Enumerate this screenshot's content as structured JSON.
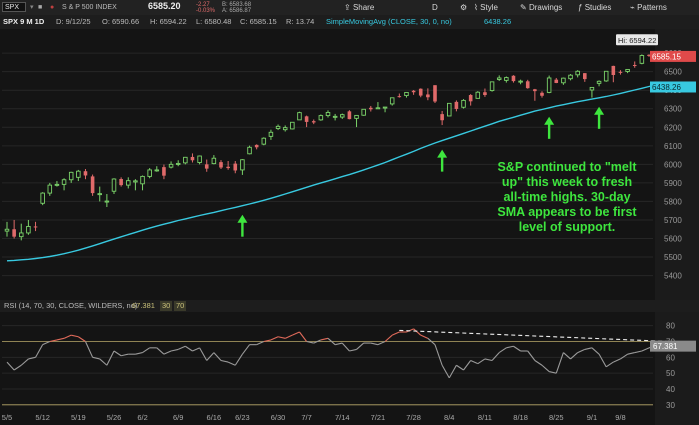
{
  "toolbar": {
    "symbol": "SPX",
    "description": "S & P 500 INDEX",
    "last_price": "6585.20",
    "change": "-2.27",
    "change_pct": "-0.03%",
    "bid": "B: 6583.68",
    "ask": "A: 6586.87",
    "share_label": "Share",
    "interval_label": "D",
    "style_label": "Style",
    "drawings_label": "Drawings",
    "studies_label": "Studies",
    "patterns_label": "Patterns"
  },
  "ohlc_bar": {
    "chart_label": "SPX 9 M 1D",
    "date": "D: 9/12/25",
    "open": "O: 6590.66",
    "high": "H: 6594.22",
    "low": "L: 6580.48",
    "close": "C: 6585.15",
    "range": "R: 13.74",
    "sma_label": "SimpleMovingAvg (CLOSE, 30, 0, no)",
    "sma_value": "6438.26"
  },
  "rsi_bar": {
    "label": "RSI (14, 70, 30, CLOSE, WILDERS, no)",
    "value": "67.381",
    "ob": "30",
    "os": "70"
  },
  "annotation": {
    "lines": [
      "S&P continued to \"melt",
      "up\" this week to fresh",
      "all-time highs. 30-day",
      "SMA appears to be first",
      "level of support."
    ]
  },
  "price_badges": {
    "hi": "Hi: 6594.22",
    "close": "6585.15",
    "sma": "6438.26"
  },
  "colors": {
    "up": "#7bd36a",
    "down": "#e06a6a",
    "sma": "#38c9e0",
    "rsi": "#9a9a9a",
    "rsi_ob": "#e06a5a",
    "annotation": "#3ee63e",
    "arrow": "#3ee63e"
  },
  "chart_data": [
    {
      "type": "candlestick",
      "y_ticks": [
        5400,
        5500,
        5600,
        5700,
        5800,
        5900,
        6000,
        6100,
        6200,
        6300,
        6400,
        6500,
        6600
      ],
      "ylim": [
        5360,
        6660
      ],
      "x_tick_labels": [
        "5/5",
        "5/12",
        "5/19",
        "5/26",
        "6/2",
        "6/9",
        "6/16",
        "6/23",
        "6/30",
        "7/7",
        "7/14",
        "7/21",
        "7/28",
        "8/4",
        "8/11",
        "8/18",
        "8/25",
        "9/1",
        "9/8"
      ],
      "candles": [
        {
          "date": "5/5",
          "o": 5640,
          "h": 5690,
          "l": 5610,
          "c": 5650
        },
        {
          "date": "5/6",
          "o": 5650,
          "h": 5700,
          "l": 5600,
          "c": 5610
        },
        {
          "date": "5/7",
          "o": 5610,
          "h": 5680,
          "l": 5590,
          "c": 5630
        },
        {
          "date": "5/8",
          "o": 5630,
          "h": 5700,
          "l": 5620,
          "c": 5665
        },
        {
          "date": "5/9",
          "o": 5665,
          "h": 5690,
          "l": 5640,
          "c": 5660
        },
        {
          "date": "5/12",
          "o": 5790,
          "h": 5850,
          "l": 5780,
          "c": 5845
        },
        {
          "date": "5/13",
          "o": 5845,
          "h": 5900,
          "l": 5830,
          "c": 5888
        },
        {
          "date": "5/14",
          "o": 5888,
          "h": 5910,
          "l": 5880,
          "c": 5892
        },
        {
          "date": "5/15",
          "o": 5892,
          "h": 5925,
          "l": 5860,
          "c": 5917
        },
        {
          "date": "5/16",
          "o": 5917,
          "h": 5960,
          "l": 5900,
          "c": 5957
        },
        {
          "date": "5/19",
          "o": 5930,
          "h": 5970,
          "l": 5910,
          "c": 5963
        },
        {
          "date": "5/20",
          "o": 5963,
          "h": 5975,
          "l": 5920,
          "c": 5940
        },
        {
          "date": "5/21",
          "o": 5935,
          "h": 5945,
          "l": 5830,
          "c": 5845
        },
        {
          "date": "5/22",
          "o": 5840,
          "h": 5880,
          "l": 5800,
          "c": 5842
        },
        {
          "date": "5/23",
          "o": 5800,
          "h": 5840,
          "l": 5770,
          "c": 5802
        },
        {
          "date": "5/27",
          "o": 5855,
          "h": 5925,
          "l": 5840,
          "c": 5921
        },
        {
          "date": "5/28",
          "o": 5921,
          "h": 5930,
          "l": 5880,
          "c": 5888
        },
        {
          "date": "5/29",
          "o": 5888,
          "h": 5930,
          "l": 5870,
          "c": 5912
        },
        {
          "date": "5/30",
          "o": 5905,
          "h": 5920,
          "l": 5860,
          "c": 5911
        },
        {
          "date": "6/2",
          "o": 5895,
          "h": 5940,
          "l": 5860,
          "c": 5935
        },
        {
          "date": "6/3",
          "o": 5935,
          "h": 5980,
          "l": 5925,
          "c": 5970
        },
        {
          "date": "6/4",
          "o": 5970,
          "h": 5990,
          "l": 5960,
          "c": 5970
        },
        {
          "date": "6/5",
          "o": 5985,
          "h": 5999,
          "l": 5920,
          "c": 5939
        },
        {
          "date": "6/6",
          "o": 5985,
          "h": 6016,
          "l": 5978,
          "c": 6000
        },
        {
          "date": "6/9",
          "o": 6004,
          "h": 6022,
          "l": 5990,
          "c": 6005
        },
        {
          "date": "6/10",
          "o": 6008,
          "h": 6040,
          "l": 6000,
          "c": 6038
        },
        {
          "date": "6/11",
          "o": 6040,
          "h": 6059,
          "l": 6010,
          "c": 6022
        },
        {
          "date": "6/12",
          "o": 6010,
          "h": 6048,
          "l": 6000,
          "c": 6045
        },
        {
          "date": "6/13",
          "o": 6000,
          "h": 6026,
          "l": 5960,
          "c": 5977
        },
        {
          "date": "6/16",
          "o": 6004,
          "h": 6050,
          "l": 6000,
          "c": 6033
        },
        {
          "date": "6/17",
          "o": 6012,
          "h": 6023,
          "l": 5975,
          "c": 5983
        },
        {
          "date": "6/18",
          "o": 5987,
          "h": 6018,
          "l": 5971,
          "c": 5980
        },
        {
          "date": "6/20",
          "o": 6004,
          "h": 6018,
          "l": 5952,
          "c": 5967
        },
        {
          "date": "6/23",
          "o": 5970,
          "h": 6028,
          "l": 5943,
          "c": 6025
        },
        {
          "date": "6/24",
          "o": 6057,
          "h": 6101,
          "l": 6054,
          "c": 6092
        },
        {
          "date": "6/25",
          "o": 6105,
          "h": 6108,
          "l": 6081,
          "c": 6092
        },
        {
          "date": "6/26",
          "o": 6109,
          "h": 6146,
          "l": 6103,
          "c": 6141
        },
        {
          "date": "6/27",
          "o": 6151,
          "h": 6187,
          "l": 6132,
          "c": 6173
        },
        {
          "date": "6/30",
          "o": 6193,
          "h": 6215,
          "l": 6185,
          "c": 6205
        },
        {
          "date": "7/1",
          "o": 6187,
          "h": 6210,
          "l": 6177,
          "c": 6198
        },
        {
          "date": "7/2",
          "o": 6191,
          "h": 6227,
          "l": 6188,
          "c": 6227
        },
        {
          "date": "7/3",
          "o": 6240,
          "h": 6284,
          "l": 6240,
          "c": 6279
        },
        {
          "date": "7/7",
          "o": 6259,
          "h": 6263,
          "l": 6201,
          "c": 6229
        },
        {
          "date": "7/8",
          "o": 6233,
          "h": 6242,
          "l": 6217,
          "c": 6226
        },
        {
          "date": "7/9",
          "o": 6240,
          "h": 6269,
          "l": 6235,
          "c": 6263
        },
        {
          "date": "7/10",
          "o": 6263,
          "h": 6291,
          "l": 6253,
          "c": 6280
        },
        {
          "date": "7/11",
          "o": 6256,
          "h": 6272,
          "l": 6237,
          "c": 6259
        },
        {
          "date": "7/14",
          "o": 6255,
          "h": 6274,
          "l": 6245,
          "c": 6268
        },
        {
          "date": "7/15",
          "o": 6286,
          "h": 6292,
          "l": 6243,
          "c": 6244
        },
        {
          "date": "7/16",
          "o": 6248,
          "h": 6264,
          "l": 6201,
          "c": 6264
        },
        {
          "date": "7/17",
          "o": 6265,
          "h": 6298,
          "l": 6262,
          "c": 6297
        },
        {
          "date": "7/18",
          "o": 6305,
          "h": 6315,
          "l": 6285,
          "c": 6297
        },
        {
          "date": "7/21",
          "o": 6304,
          "h": 6336,
          "l": 6303,
          "c": 6305
        },
        {
          "date": "7/22",
          "o": 6306,
          "h": 6310,
          "l": 6281,
          "c": 6309
        },
        {
          "date": "7/23",
          "o": 6326,
          "h": 6360,
          "l": 6317,
          "c": 6359
        },
        {
          "date": "7/24",
          "o": 6368,
          "h": 6382,
          "l": 6360,
          "c": 6363
        },
        {
          "date": "7/25",
          "o": 6371,
          "h": 6389,
          "l": 6360,
          "c": 6388
        },
        {
          "date": "7/28",
          "o": 6397,
          "h": 6401,
          "l": 6375,
          "c": 6389
        },
        {
          "date": "7/29",
          "o": 6408,
          "h": 6410,
          "l": 6362,
          "c": 6371
        },
        {
          "date": "7/30",
          "o": 6377,
          "h": 6410,
          "l": 6346,
          "c": 6362
        },
        {
          "date": "7/31",
          "o": 6427,
          "h": 6427,
          "l": 6331,
          "c": 6339
        },
        {
          "date": "8/1",
          "o": 6271,
          "h": 6288,
          "l": 6212,
          "c": 6238
        },
        {
          "date": "8/4",
          "o": 6261,
          "h": 6331,
          "l": 6261,
          "c": 6329
        },
        {
          "date": "8/5",
          "o": 6337,
          "h": 6345,
          "l": 6286,
          "c": 6299
        },
        {
          "date": "8/6",
          "o": 6308,
          "h": 6352,
          "l": 6301,
          "c": 6345
        },
        {
          "date": "8/7",
          "o": 6374,
          "h": 6379,
          "l": 6317,
          "c": 6340
        },
        {
          "date": "8/8",
          "o": 6356,
          "h": 6395,
          "l": 6355,
          "c": 6389
        },
        {
          "date": "8/11",
          "o": 6389,
          "h": 6409,
          "l": 6364,
          "c": 6374
        },
        {
          "date": "8/12",
          "o": 6398,
          "h": 6446,
          "l": 6392,
          "c": 6445
        },
        {
          "date": "8/13",
          "o": 6458,
          "h": 6480,
          "l": 6450,
          "c": 6466
        },
        {
          "date": "8/14",
          "o": 6453,
          "h": 6474,
          "l": 6441,
          "c": 6468
        },
        {
          "date": "8/15",
          "o": 6478,
          "h": 6481,
          "l": 6441,
          "c": 6449
        },
        {
          "date": "8/18",
          "o": 6445,
          "h": 6457,
          "l": 6432,
          "c": 6449
        },
        {
          "date": "8/19",
          "o": 6448,
          "h": 6456,
          "l": 6408,
          "c": 6411
        },
        {
          "date": "8/20",
          "o": 6405,
          "h": 6407,
          "l": 6343,
          "c": 6395
        },
        {
          "date": "8/21",
          "o": 6386,
          "h": 6394,
          "l": 6360,
          "c": 6370
        },
        {
          "date": "8/22",
          "o": 6388,
          "h": 6479,
          "l": 6384,
          "c": 6466
        },
        {
          "date": "8/25",
          "o": 6457,
          "h": 6466,
          "l": 6438,
          "c": 6439
        },
        {
          "date": "8/26",
          "o": 6440,
          "h": 6468,
          "l": 6429,
          "c": 6465
        },
        {
          "date": "8/27",
          "o": 6462,
          "h": 6487,
          "l": 6453,
          "c": 6481
        },
        {
          "date": "8/28",
          "o": 6483,
          "h": 6508,
          "l": 6469,
          "c": 6502
        },
        {
          "date": "8/29",
          "o": 6492,
          "h": 6492,
          "l": 6445,
          "c": 6460
        },
        {
          "date": "9/2",
          "o": 6401,
          "h": 6416,
          "l": 6360,
          "c": 6415
        },
        {
          "date": "9/3",
          "o": 6437,
          "h": 6453,
          "l": 6421,
          "c": 6448
        },
        {
          "date": "9/4",
          "o": 6450,
          "h": 6502,
          "l": 6445,
          "c": 6502
        },
        {
          "date": "9/5",
          "o": 6531,
          "h": 6532,
          "l": 6443,
          "c": 6482
        },
        {
          "date": "9/8",
          "o": 6499,
          "h": 6508,
          "l": 6484,
          "c": 6496
        },
        {
          "date": "9/9",
          "o": 6501,
          "h": 6513,
          "l": 6492,
          "c": 6512
        },
        {
          "date": "9/10",
          "o": 6536,
          "h": 6555,
          "l": 6521,
          "c": 6532
        },
        {
          "date": "9/11",
          "o": 6545,
          "h": 6593,
          "l": 6540,
          "c": 6587
        },
        {
          "date": "9/12",
          "o": 6591,
          "h": 6594,
          "l": 6580,
          "c": 6585
        }
      ],
      "sma_30": [
        5480,
        5482,
        5485,
        5488,
        5492,
        5497,
        5503,
        5510,
        5518,
        5527,
        5537,
        5548,
        5560,
        5572,
        5585,
        5597,
        5609,
        5621,
        5633,
        5645,
        5656,
        5667,
        5677,
        5687,
        5697,
        5706,
        5715,
        5724,
        5733,
        5741,
        5750,
        5759,
        5768,
        5777,
        5786,
        5796,
        5806,
        5817,
        5828,
        5840,
        5852,
        5864,
        5876,
        5888,
        5900,
        5911,
        5922,
        5934,
        5945,
        5957,
        5970,
        5983,
        5996,
        6010,
        6025,
        6040,
        6055,
        6070,
        6086,
        6101,
        6115,
        6128,
        6141,
        6154,
        6167,
        6180,
        6193,
        6206,
        6219,
        6232,
        6243,
        6254,
        6265,
        6276,
        6287,
        6296,
        6305,
        6314,
        6322,
        6330,
        6338,
        6345,
        6352,
        6359,
        6366,
        6374,
        6383,
        6392,
        6401,
        6410,
        6420,
        6429,
        6438
      ]
    },
    {
      "type": "line",
      "title": "RSI (14, 70, 30, CLOSE, WILDERS, no)",
      "y_ticks": [
        30,
        40,
        50,
        60,
        70,
        80
      ],
      "ylim": [
        28,
        88
      ],
      "levels": [
        70,
        30
      ],
      "overbought_threshold": 70,
      "values": [
        57,
        52,
        55,
        59,
        60,
        68,
        70,
        71,
        72,
        74,
        73,
        70,
        60,
        59,
        55,
        64,
        61,
        62,
        62,
        63,
        66,
        66,
        62,
        64,
        65,
        67,
        64,
        66,
        58,
        63,
        58,
        57,
        55,
        62,
        68,
        68,
        70,
        71,
        73,
        72,
        74,
        76,
        70,
        69,
        71,
        72,
        68,
        69,
        64,
        65,
        69,
        69,
        68,
        70,
        74,
        76,
        76,
        78,
        74,
        72,
        68,
        55,
        47,
        55,
        52,
        58,
        56,
        59,
        58,
        63,
        66,
        67,
        64,
        64,
        58,
        55,
        51,
        50,
        63,
        59,
        63,
        65,
        66,
        62,
        54,
        57,
        59,
        62,
        63,
        64,
        66,
        67,
        67.381
      ],
      "trendline": {
        "start_index": 55,
        "start_value": 77,
        "end_index": 92,
        "end_value": 70
      }
    }
  ]
}
